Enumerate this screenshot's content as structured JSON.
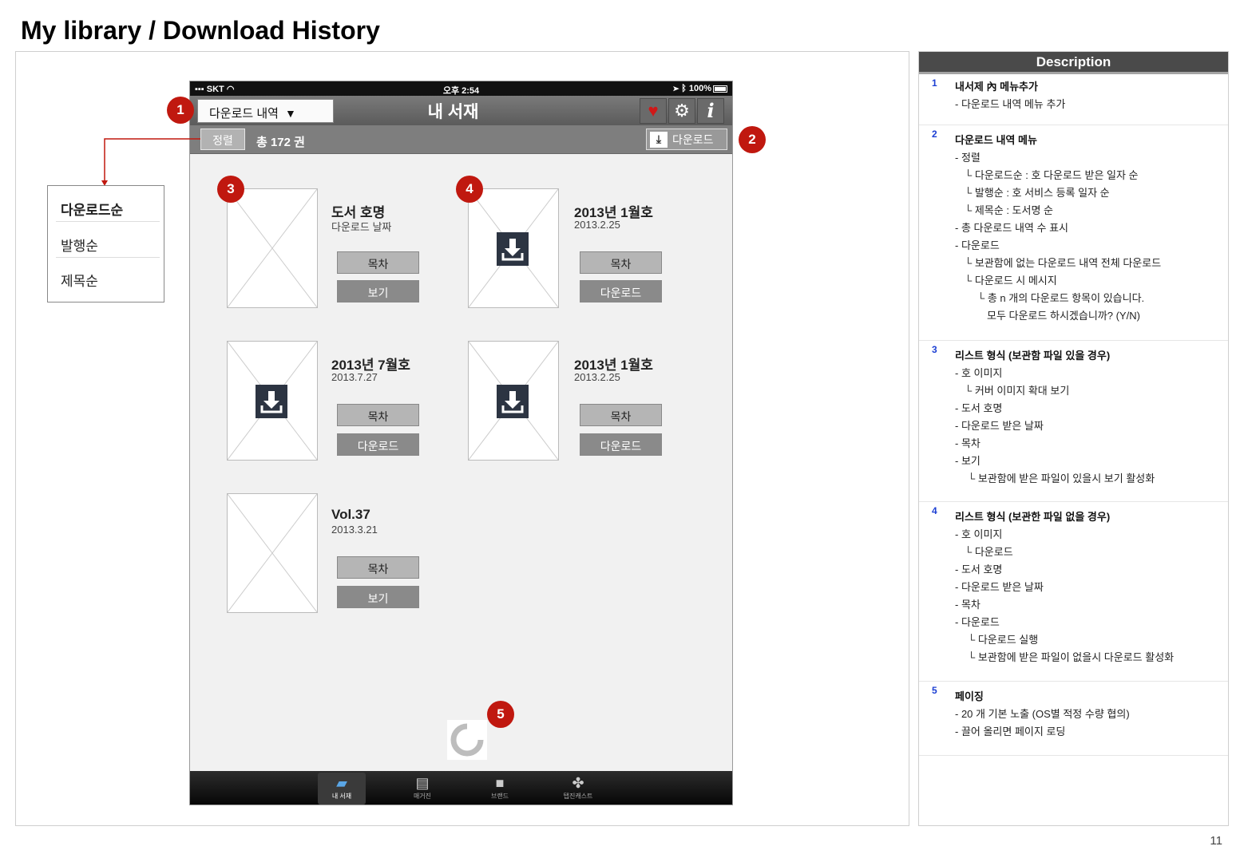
{
  "page": {
    "title": "My library / Download History",
    "page_number": "11"
  },
  "status_bar": {
    "carrier": "SKT",
    "time": "오후 2:54",
    "battery": "100%"
  },
  "nav": {
    "select_label": "다운로드 내역",
    "select_caret": "▼",
    "title": "내 서재"
  },
  "toolbar": {
    "sort_label": "정렬",
    "total_count": "총 172 권",
    "download_all_label": "다운로드"
  },
  "books": [
    {
      "title": "도서 호명",
      "date": "다운로드 날짜",
      "toc_label": "목차",
      "action_label": "보기",
      "downloadable": false
    },
    {
      "title": "2013년 1월호",
      "date": "2013.2.25",
      "toc_label": "목차",
      "action_label": "다운로드",
      "downloadable": true
    },
    {
      "title": "2013년 7월호",
      "date": "2013.7.27",
      "toc_label": "목차",
      "action_label": "다운로드",
      "downloadable": true
    },
    {
      "title": "2013년 1월호",
      "date": "2013.2.25",
      "toc_label": "목차",
      "action_label": "다운로드",
      "downloadable": true
    },
    {
      "title": "Vol.37",
      "date": "2013.3.21",
      "toc_label": "목차",
      "action_label": "보기",
      "downloadable": false
    }
  ],
  "tabbar": {
    "tabs": [
      {
        "label": "내 서재",
        "icon": "folder-icon",
        "active": true
      },
      {
        "label": "매거진",
        "icon": "magazine-icon",
        "active": false
      },
      {
        "label": "브랜드",
        "icon": "bag-icon",
        "active": false
      },
      {
        "label": "탭진캐스트",
        "icon": "gift-icon",
        "active": false
      }
    ]
  },
  "sort_menu": {
    "items": [
      "다운로드순",
      "발행순",
      "제목순"
    ]
  },
  "callouts": [
    "1",
    "2",
    "3",
    "4",
    "5"
  ],
  "description": {
    "header": "Description",
    "sections": [
      {
        "num": "1",
        "title": "내서제 內 메뉴추가",
        "lines": [
          "- 다운로드 내역 메뉴 추가"
        ]
      },
      {
        "num": "2",
        "title": "다운로드 내역 메뉴",
        "lines": [
          "- 정렬",
          "└ 다운로드순 : 호 다운로드 받은 일자 순",
          "└ 발행순 : 호 서비스 등록 일자 순",
          "└ 제목순 : 도서명 순",
          "- 총 다운로드 내역 수 표시",
          "- 다운로드",
          "└ 보관함에 없는 다운로드 내역 전체 다운로드",
          "└ 다운로드 시 메시지",
          "└ 총 n 개의 다운로드 항목이 있습니다.",
          "모두 다운로드 하시겠습니까? (Y/N)"
        ]
      },
      {
        "num": "3",
        "title": "리스트 형식 (보관함 파일 있을 경우)",
        "lines": [
          "- 호 이미지",
          "└ 커버 이미지 확대 보기",
          "- 도서 호명",
          "- 다운로드 받은 날짜",
          "- 목차",
          "- 보기",
          "└ 보관함에 받은 파일이 있을시 보기 활성화"
        ]
      },
      {
        "num": "4",
        "title": "리스트 형식 (보관한 파일 없을 경우)",
        "lines": [
          "- 호 이미지",
          "└ 다운로드",
          "- 도서 호명",
          "- 다운로드 받은 날짜",
          "- 목차",
          "- 다운로드",
          "└ 다운로드 실행",
          "└ 보관함에 받은 파일이 없을시 다운로드 활성화"
        ]
      },
      {
        "num": "5",
        "title": "페이징",
        "lines": [
          "- 20 개 기본 노출 (OS별 적정 수량 협의)",
          "- 끌어 올리면 페이지 로딩"
        ]
      }
    ]
  },
  "colors": {
    "callout": "#c0180f",
    "desc_number": "#1c3fd3",
    "heart": "#d01818",
    "download_badge": "#2c3442"
  }
}
